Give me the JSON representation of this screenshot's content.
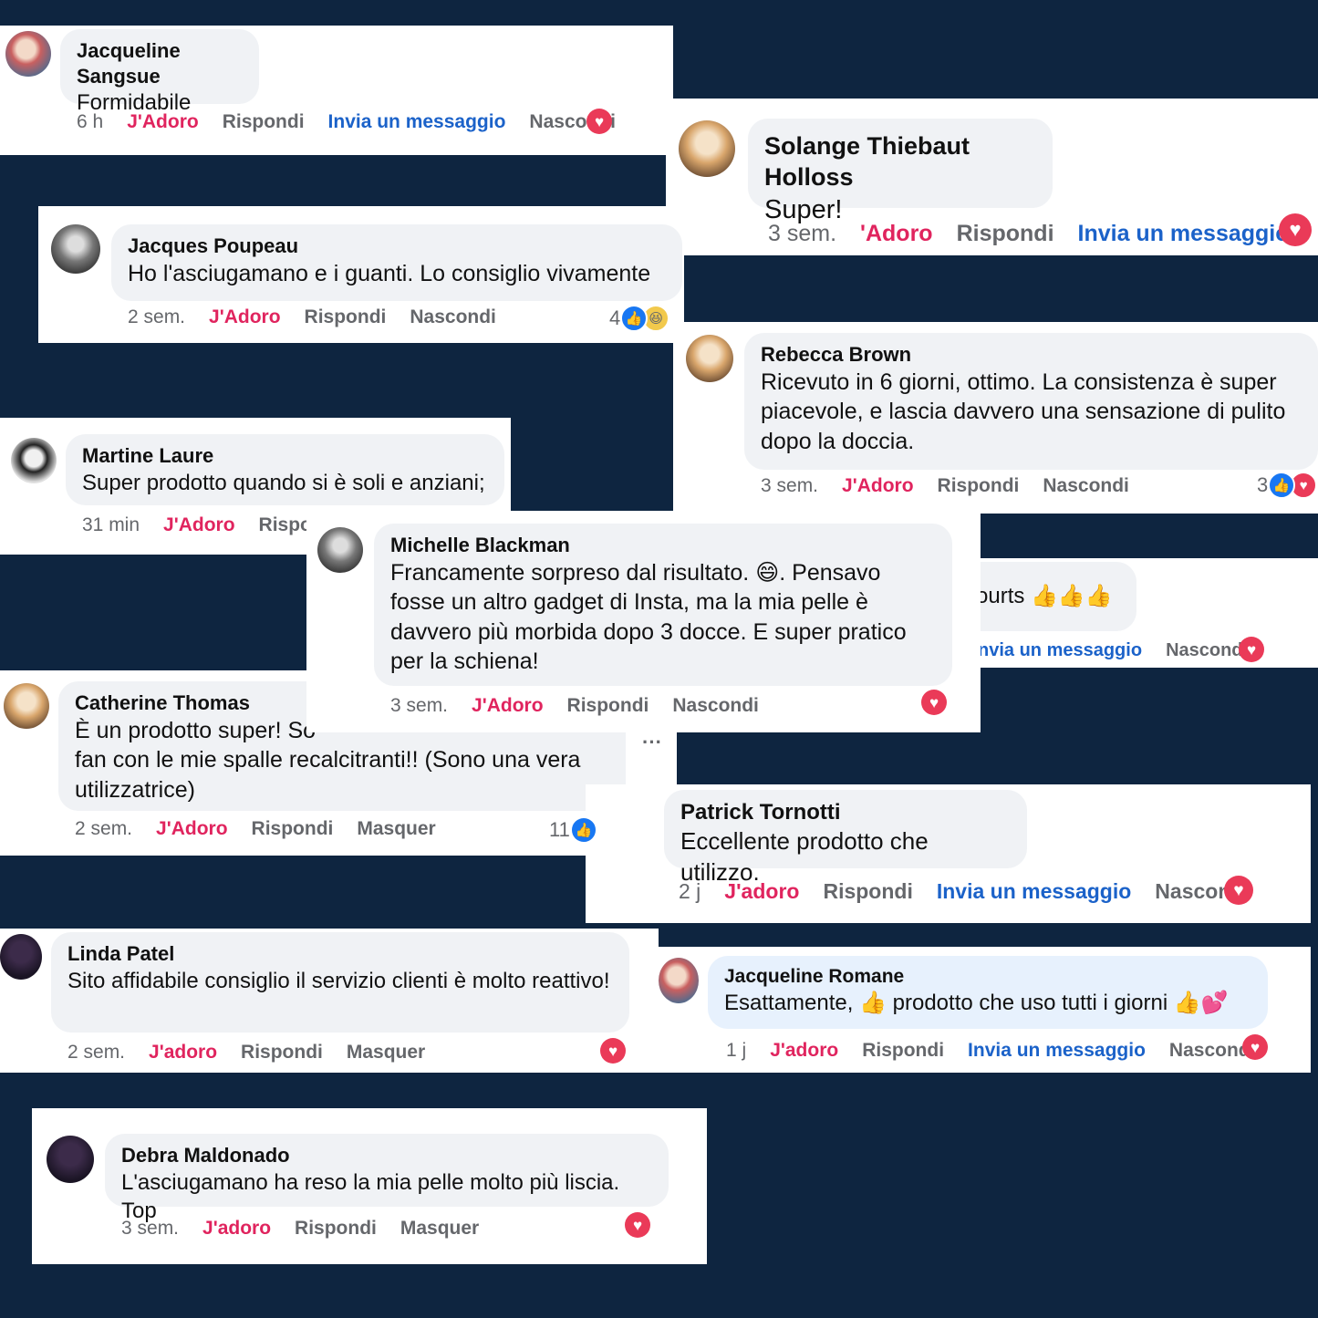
{
  "comments": [
    {
      "id": "c1",
      "name": "Jacqueline Sangsue",
      "text": "Formidabile",
      "time": "6 h",
      "like": "J'Adoro",
      "reply": "Rispondi",
      "message": "Invia un messaggio",
      "hide": "Nascondi"
    },
    {
      "id": "c2",
      "name": "Solange Thiebaut Holloss",
      "text": "Super!",
      "time": "3 sem.",
      "like": "'Adoro",
      "reply": "Rispondi",
      "message": "Invia un messaggio"
    },
    {
      "id": "c3",
      "name": "Jacques Poupeau",
      "text": "Ho l'asciugamano e i guanti. Lo consiglio vivamente",
      "time": "2 sem.",
      "like": "J'Adoro",
      "reply": "Rispondi",
      "hide": "Nascondi",
      "reactions": "4"
    },
    {
      "id": "c4",
      "name": "Rebecca Brown",
      "text": "Ricevuto in 6 giorni, ottimo. La consistenza è super piacevole, e lascia davvero una sensazione di pulito dopo la doccia.",
      "time": "3 sem.",
      "like": "J'Adoro",
      "reply": "Rispondi",
      "hide": "Nascondi",
      "reactions": "3"
    },
    {
      "id": "c5",
      "name": "Martine Laure",
      "text": "Super prodotto quando si è soli e anziani;",
      "time": "31 min",
      "like": "J'Adoro",
      "reply": "Rispond"
    },
    {
      "id": "c6",
      "name": "Michelle Blackman",
      "text_a": "Francamente sorpreso dal risultato. ",
      "emoji": "😄",
      "text_b": ". Pensavo fosse un altro gadget di Insta, ma la mia pelle è davvero più morbida dopo 3 docce. E super pratico per la schiena!",
      "time": "3 sem.",
      "like": "J'Adoro",
      "reply": "Rispondi",
      "hide": "Nascondi"
    },
    {
      "id": "c7",
      "text": "courts 👍👍👍",
      "message": "nvia un messaggio",
      "hide": "Nascondi"
    },
    {
      "id": "c8",
      "name": "Catherine Thomas",
      "text_a": "È un prodotto super! So",
      "text_b": "fan con le mie spalle recalcitranti!! (Sono una vera utilizzatrice)",
      "time": "2 sem.",
      "like": "J'Adoro",
      "reply": "Rispondi",
      "hide": "Masquer",
      "reactions": "11"
    },
    {
      "id": "c9",
      "name": "Patrick Tornotti",
      "text": "Eccellente prodotto che utilizzo.",
      "time": "2 j",
      "like": "J'adoro",
      "reply": "Rispondi",
      "message": "Invia un messaggio",
      "hide": "Nascondi"
    },
    {
      "id": "c10",
      "name": "Linda Patel",
      "text": "Sito affidabile consiglio il servizio clienti è molto reattivo!",
      "time": "2 sem.",
      "like": "J'adoro",
      "reply": "Rispondi",
      "hide": "Masquer"
    },
    {
      "id": "c11",
      "name": "Jacqueline Romane",
      "text_a": "Esattamente, ",
      "emoji_a": "👍",
      "text_b": " prodotto che uso tutti i giorni ",
      "emoji_b": "👍💕",
      "time": "1 j",
      "like": "J'adoro",
      "reply": "Rispondi",
      "message": "Invia un messaggio",
      "hide": "Nascondi"
    },
    {
      "id": "c12",
      "name": "Debra Maldonado",
      "text": "L'asciugamano ha reso la mia pelle molto più liscia. Top",
      "time": "3 sem.",
      "like": "J'adoro",
      "reply": "Rispondi",
      "hide": "Masquer"
    }
  ],
  "icons": {
    "heart": "♥",
    "thumb": "👍",
    "laugh": "😆",
    "more": "···"
  },
  "colors": {
    "background": "#0e2540",
    "like": "#e0245e",
    "message": "#1b62c9",
    "heart": "#ea3a58",
    "bubble": "#f0f2f5"
  }
}
